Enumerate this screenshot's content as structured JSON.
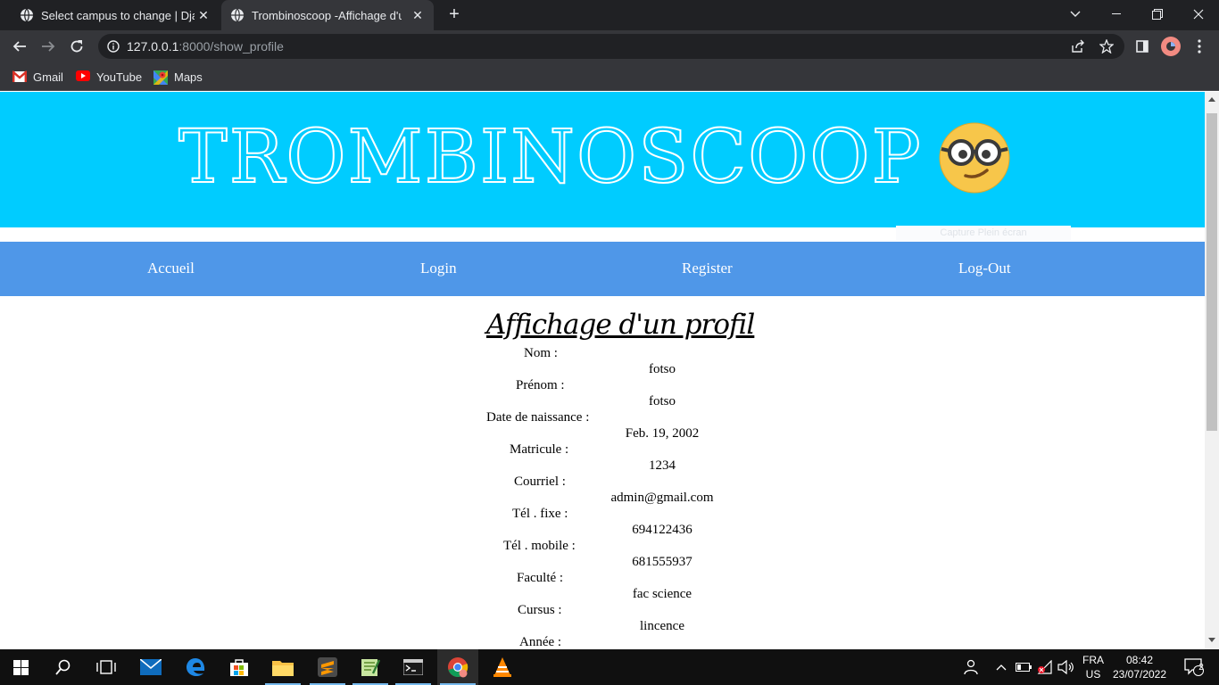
{
  "browser": {
    "tabs": [
      {
        "title": "Select campus to change | Django"
      },
      {
        "title": "Trombinoscoop -Affichage d'un profil"
      }
    ],
    "url_host": "127.0.0.1",
    "url_path": ":8000/show_profile",
    "bookmarks": [
      {
        "label": "Gmail",
        "icon": "gmail-icon"
      },
      {
        "label": "YouTube",
        "icon": "youtube-icon"
      },
      {
        "label": "Maps",
        "icon": "maps-icon"
      }
    ]
  },
  "page": {
    "banner_title": "TROMBINOSCOOP",
    "banner_emoji": "nerd-face-emoji",
    "capture_hint": "Capture Plein écran",
    "menu": [
      "Accueil",
      "Login",
      "Register",
      "Log-Out"
    ],
    "title": "Affichage d'un profil",
    "fields": [
      {
        "label": "Nom :",
        "value": "fotso"
      },
      {
        "label": "Prénom :",
        "value": "fotso"
      },
      {
        "label": "Date de naissance :",
        "value": "Feb. 19, 2002"
      },
      {
        "label": "Matricule :",
        "value": "1234"
      },
      {
        "label": "Courriel :",
        "value": "admin@gmail.com"
      },
      {
        "label": "Tél . fixe :",
        "value": "694122436"
      },
      {
        "label": "Tél . mobile :",
        "value": "681555937"
      },
      {
        "label": "Faculté :",
        "value": "fac science"
      },
      {
        "label": "Cursus :",
        "value": "lincence"
      },
      {
        "label": "Année :",
        "value": ""
      }
    ]
  },
  "taskbar": {
    "lang_top": "FRA",
    "lang_bottom": "US",
    "time": "08:42",
    "date": "23/07/2022",
    "notification_count": "2"
  },
  "colors": {
    "banner": "#00ccff",
    "menu": "#4f97e8",
    "chrome_dark": "#202124",
    "chrome_toolbar": "#35363a"
  }
}
